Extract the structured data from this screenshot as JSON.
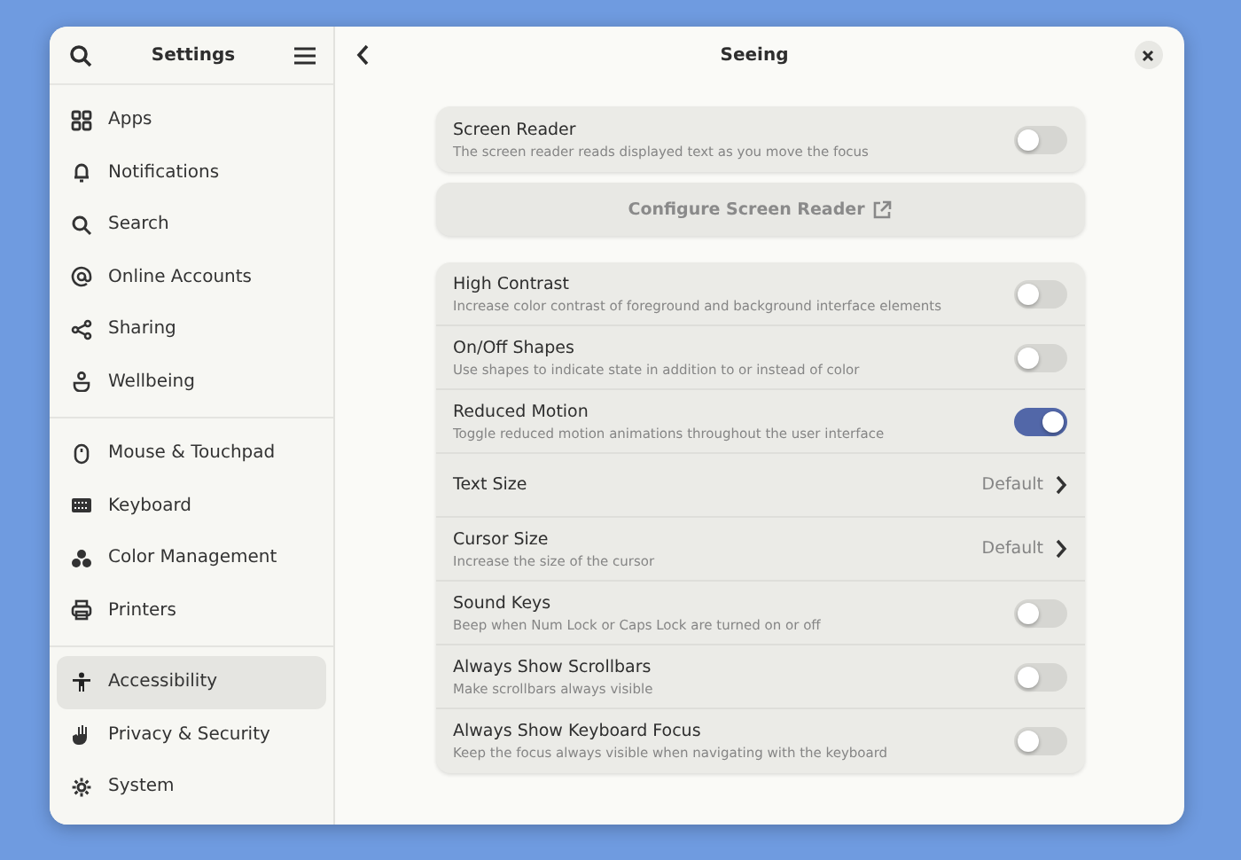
{
  "sidebar": {
    "title": "Settings",
    "groups": [
      {
        "items": [
          {
            "label": "Apps",
            "selected": false
          },
          {
            "label": "Notifications",
            "selected": false
          },
          {
            "label": "Search",
            "selected": false
          },
          {
            "label": "Online Accounts",
            "selected": false
          },
          {
            "label": "Sharing",
            "selected": false
          },
          {
            "label": "Wellbeing",
            "selected": false
          }
        ]
      },
      {
        "items": [
          {
            "label": "Mouse & Touchpad",
            "selected": false
          },
          {
            "label": "Keyboard",
            "selected": false
          },
          {
            "label": "Color Management",
            "selected": false
          },
          {
            "label": "Printers",
            "selected": false
          }
        ]
      },
      {
        "items": [
          {
            "label": "Accessibility",
            "selected": true
          },
          {
            "label": "Privacy & Security",
            "selected": false
          },
          {
            "label": "System",
            "selected": false
          }
        ]
      }
    ]
  },
  "page": {
    "title": "Seeing",
    "screen_reader": {
      "title": "Screen Reader",
      "subtitle": "The screen reader reads displayed text as you move the focus",
      "on": false
    },
    "configure_button": {
      "label": "Configure Screen Reader"
    },
    "rows": [
      {
        "kind": "switch",
        "title": "High Contrast",
        "subtitle": "Increase color contrast of foreground and background interface elements",
        "on": false
      },
      {
        "kind": "switch",
        "title": "On/Off Shapes",
        "subtitle": "Use shapes to indicate state in addition to or instead of color",
        "on": false
      },
      {
        "kind": "switch",
        "title": "Reduced Motion",
        "subtitle": "Toggle reduced motion animations throughout the user interface",
        "on": true
      },
      {
        "kind": "value",
        "title": "Text Size",
        "value": "Default"
      },
      {
        "kind": "value",
        "title": "Cursor Size",
        "subtitle": "Increase the size of the cursor",
        "value": "Default"
      },
      {
        "kind": "switch",
        "title": "Sound Keys",
        "subtitle": "Beep when Num Lock or Caps Lock are turned on or off",
        "on": false
      },
      {
        "kind": "switch",
        "title": "Always Show Scrollbars",
        "subtitle": "Make scrollbars always visible",
        "on": false
      },
      {
        "kind": "switch",
        "title": "Always Show Keyboard Focus",
        "subtitle": "Keep the focus always visible when navigating with the keyboard",
        "on": false
      }
    ]
  }
}
